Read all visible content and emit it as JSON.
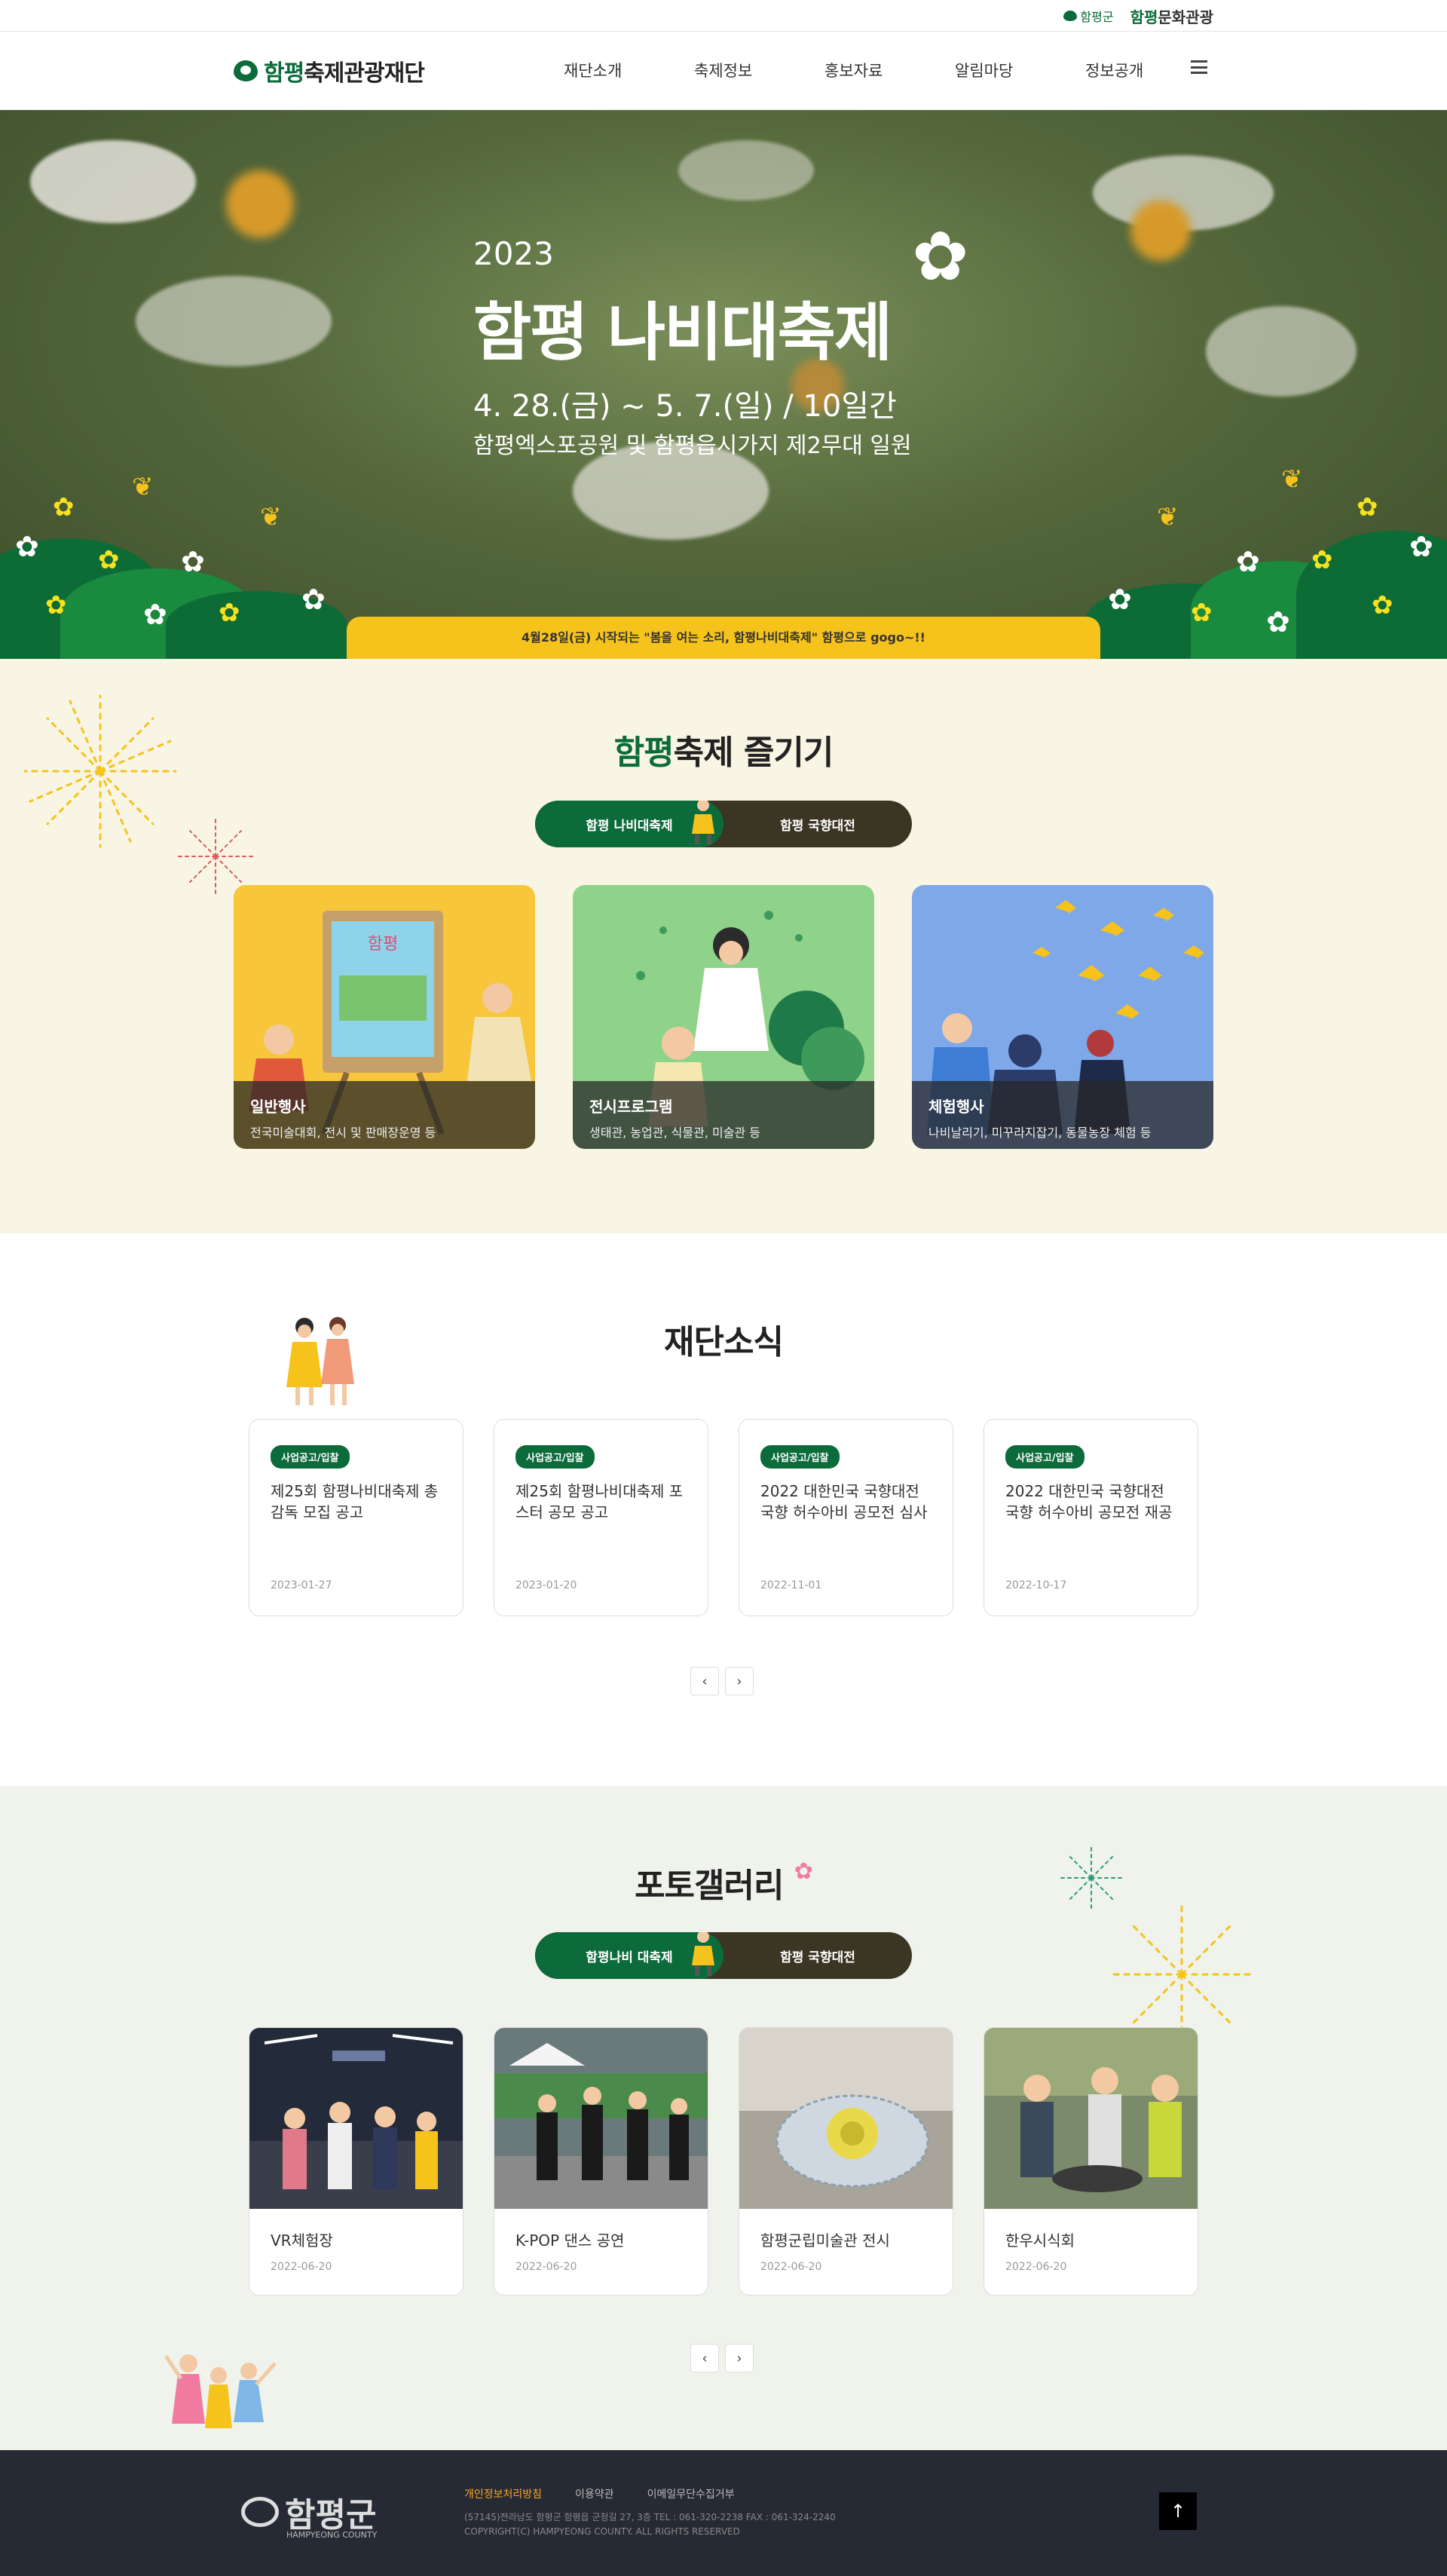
{
  "util": {
    "county": "함평군",
    "culture_prefix": "함평",
    "culture_rest": "문화관광"
  },
  "header": {
    "logo_prefix": "함평",
    "logo_rest": "축제관광재단",
    "menu": [
      "재단소개",
      "축제정보",
      "홍보자료",
      "알림마당",
      "정보공개"
    ]
  },
  "hero": {
    "year": "2023",
    "title": "함평 나비대축제",
    "date": "4. 28.(금) ~ 5. 7.(일) / 10일간",
    "place": "함평엑스포공원 및 함평읍시가지 제2무대 일원",
    "ribbon": "4월28일(금) 시작되는 \"봄을 여는 소리, 함평나비대축제\" 함평으로 gogo~!!"
  },
  "festival": {
    "title_prefix": "함평",
    "title_rest": "축제 즐기기",
    "tabs": [
      "함평 나비대축제",
      "함평 국향대전"
    ],
    "cards": [
      {
        "title": "일반행사",
        "desc": "전국미술대회, 전시 및 판매장운영 등"
      },
      {
        "title": "전시프로그램",
        "desc": "생태관, 농업관, 식물관, 미술관 등"
      },
      {
        "title": "체험행사",
        "desc": "나비날리기, 미꾸라지잡기, 동물농장 체험 등"
      }
    ]
  },
  "news": {
    "title": "재단소식",
    "items": [
      {
        "badge": "사업공고/입찰",
        "title": "제25회 함평나비대축제 총감독 모집 공고",
        "date": "2023-01-27"
      },
      {
        "badge": "사업공고/입찰",
        "title": "제25회 함평나비대축제 포스터 공모 공고",
        "date": "2023-01-20"
      },
      {
        "badge": "사업공고/입찰",
        "title": "2022 대한민국 국향대전 국향 허수아비 공모전 심사",
        "date": "2022-11-01"
      },
      {
        "badge": "사업공고/입찰",
        "title": "2022 대한민국 국향대전 국향 허수아비 공모전 재공",
        "date": "2022-10-17"
      }
    ],
    "prev": "‹",
    "next": "›"
  },
  "gallery": {
    "title": "포토갤러리",
    "tabs": [
      "함평나비 대축제",
      "함평 국향대전"
    ],
    "items": [
      {
        "title": "VR체험장",
        "date": "2022-06-20"
      },
      {
        "title": "K-POP 댄스 공연",
        "date": "2022-06-20"
      },
      {
        "title": "함평군립미술관 전시",
        "date": "2022-06-20"
      },
      {
        "title": "한우시식회",
        "date": "2022-06-20"
      }
    ],
    "prev": "‹",
    "next": "›"
  },
  "footer": {
    "logo": "함평군",
    "logo_sub": "HAMPYEONG COUNTY",
    "links": [
      "개인정보처리방침",
      "이용약관",
      "이메일무단수집거부"
    ],
    "address": "(57145)전라남도 함평군 함평읍 군청길 27, 3층 TEL : 061-320-2238 FAX : 061-324-2240",
    "copyright": "COPYRIGHT(C) HAMPYEONG COUNTY. ALL RIGHTS RESERVED",
    "top": "↑"
  },
  "colors": {
    "green": "#0c6b3a",
    "yellow": "#f6c21c",
    "cream": "#f8f5e4",
    "mint": "#eff3ec",
    "footer": "#262a35"
  }
}
